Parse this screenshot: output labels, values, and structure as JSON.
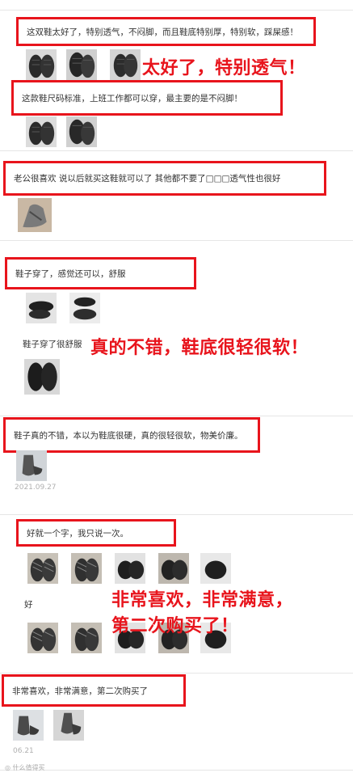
{
  "reviews": [
    {
      "text": "这双鞋太好了，特别透气，不闷脚，而且鞋底特别厚，特别软，踩屎感！",
      "thumbs": [
        "shoe-photo-dark-mesh",
        "shoe-photo-dark-mesh",
        "shoe-photo-dark-mesh"
      ]
    },
    {
      "text": "这款鞋尺码标准，上班工作都可以穿，最主要的是不闷脚！",
      "thumbs": [
        "shoe-photo-dark-mesh",
        "shoe-photo-dark-mesh"
      ]
    },
    {
      "text": "老公很喜欢 说以后就买这鞋就可以了 其他都不要了□□□透气性也很好",
      "thumbs": [
        "shoe-photo-grey-on-floor"
      ]
    },
    {
      "text": "鞋子穿了，感觉还可以，舒服",
      "thumbs": [
        "shoe-photo-black-pair",
        "shoe-photo-black-pair"
      ]
    },
    {
      "text": "鞋子穿了很舒服",
      "thumbs": [
        "shoe-photo-black-pair-top"
      ]
    },
    {
      "text": "鞋子真的不错，本以为鞋底很硬，真的很轻很软，物美价廉。",
      "thumbs": [
        "shoe-photo-worn-grey"
      ],
      "date": "2021.09.27"
    },
    {
      "text": "好就一个字，我只说一次。",
      "thumbs": [
        "shoe-photo-mesh-pair",
        "shoe-photo-mesh-pair",
        "shoe-photo-black-pair",
        "shoe-photo-black-pair",
        "shoe-photo-black-pair"
      ]
    },
    {
      "text": "好",
      "thumbs": [
        "shoe-photo-mesh-pair",
        "shoe-photo-mesh-pair",
        "shoe-photo-black-pair",
        "shoe-photo-black-pair",
        "shoe-photo-black-pair"
      ]
    },
    {
      "text": "非常喜欢，非常满意，第二次购买了",
      "thumbs": [
        "shoe-photo-grey-worn",
        "shoe-photo-grey-worn"
      ],
      "date": "06.21"
    }
  ],
  "overlays": {
    "line1": "太好了，特别透气！",
    "line2": "真的不错，鞋底很轻很软！",
    "line3a": "非常喜欢，非常满意，",
    "line3b": "第二次购买了！"
  },
  "watermark": "什么值得买",
  "colors": {
    "highlight": "#e8141c",
    "text": "#333333",
    "date": "#b0b0b0"
  }
}
